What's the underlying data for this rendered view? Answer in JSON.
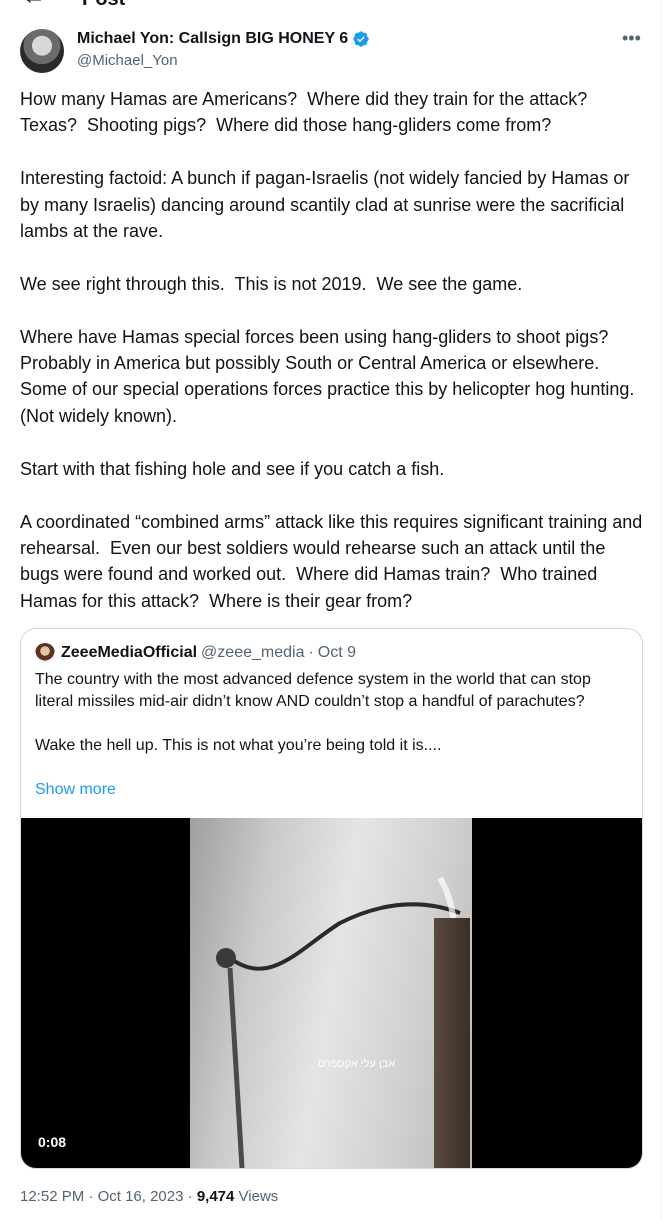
{
  "header": {
    "title": "Post",
    "back_icon": "arrow-left-icon"
  },
  "author": {
    "name": "Michael Yon: Callsign BIG HONEY 6",
    "handle": "@Michael_Yon",
    "verified_color": "#1d9bf0",
    "more_icon": "more-horizontal-icon"
  },
  "post": {
    "text": "How many Hamas are Americans?  Where did they train for the attack?  Texas?  Shooting pigs?  Where did those hang-gliders come from?\n\nInteresting factoid: A bunch if pagan-Israelis (not widely fancied by Hamas or by many Israelis) dancing around scantily clad at sunrise were the sacrificial lambs at the rave.\n\nWe see right through this.  This is not 2019.  We see the game.\n\nWhere have Hamas special forces been using hang-gliders to shoot pigs?  Probably in America but possibly South or Central America or elsewhere.  Some of our special operations forces practice this by helicopter hog hunting.  (Not widely known).\n\nStart with that fishing hole and see if you catch a fish.\n\nA coordinated “combined arms” attack like this requires significant training and rehearsal.  Even our best soldiers would rehearse such an attack until the bugs were found and worked out.  Where did Hamas train?  Who trained Hamas for this attack?  Where is their gear from?"
  },
  "quote": {
    "name": "ZeeeMediaOfficial",
    "handle": "@zeee_media",
    "separator": "·",
    "date": "Oct 9",
    "text": "The country with the most advanced defence system in the world that can stop literal missiles mid-air didn’t know AND couldn’t stop a handful of parachutes?\n\nWake the hell up. This is not what you’re being told it is....",
    "show_more": "Show more",
    "video": {
      "caption": "אבן עלי אקספרס",
      "duration": "0:08"
    }
  },
  "footer": {
    "time": "12:52 PM",
    "dot1": "·",
    "date": "Oct 16, 2023",
    "dot2": "·",
    "views_count": "9,474",
    "views_label": "Views"
  },
  "colors": {
    "accent": "#1d9bf0",
    "secondary_text": "#536471",
    "border": "#cfd9de"
  }
}
